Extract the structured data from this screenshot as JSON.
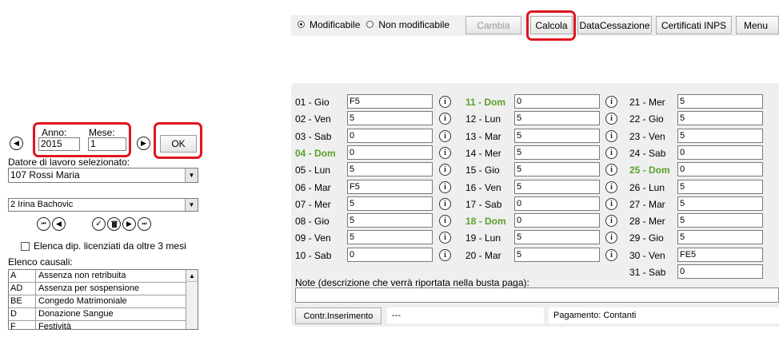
{
  "toolbar": {
    "radio_modificabile": "Modificabile",
    "radio_non_modificabile": "Non modificabile",
    "cambia": "Cambia",
    "calcola": "Calcola",
    "data_cessazione": "DataCessazione",
    "certificati_inps": "Certificati INPS",
    "menu": "Menu"
  },
  "left": {
    "anno_label": "Anno:",
    "mese_label": "Mese:",
    "anno_value": "2015",
    "mese_value": "1",
    "ok": "OK",
    "datore_label": "Datore di lavoro selezionato:",
    "datore_value": "107 Rossi Maria",
    "dipendente_value": "2 Irina Bachovic",
    "elenca_label": "Elenca dip. licenziati da oltre 3 mesi",
    "causali_label": "Elenco causali:",
    "causali": [
      {
        "code": "A",
        "desc": "Assenza non retribuita"
      },
      {
        "code": "AD",
        "desc": "Assenza per sospensione"
      },
      {
        "code": "BE",
        "desc": "Congedo Matrimoniale"
      },
      {
        "code": "D",
        "desc": "Donazione Sangue"
      },
      {
        "code": "F",
        "desc": "Festività"
      }
    ]
  },
  "calendar": {
    "col1": [
      {
        "label": "01 - Gio",
        "value": "F5",
        "sunday": false
      },
      {
        "label": "02 - Ven",
        "value": "5",
        "sunday": false
      },
      {
        "label": "03 - Sab",
        "value": "0",
        "sunday": false
      },
      {
        "label": "04 - Dom",
        "value": "0",
        "sunday": true
      },
      {
        "label": "05 - Lun",
        "value": "5",
        "sunday": false
      },
      {
        "label": "06 - Mar",
        "value": "F5",
        "sunday": false
      },
      {
        "label": "07 - Mer",
        "value": "5",
        "sunday": false
      },
      {
        "label": "08 - Gio",
        "value": "5",
        "sunday": false
      },
      {
        "label": "09 - Ven",
        "value": "5",
        "sunday": false
      },
      {
        "label": "10 - Sab",
        "value": "0",
        "sunday": false
      }
    ],
    "col2": [
      {
        "label": "11 - Dom",
        "value": "0",
        "sunday": true
      },
      {
        "label": "12 - Lun",
        "value": "5",
        "sunday": false
      },
      {
        "label": "13 - Mar",
        "value": "5",
        "sunday": false
      },
      {
        "label": "14 - Mer",
        "value": "5",
        "sunday": false
      },
      {
        "label": "15 - Gio",
        "value": "5",
        "sunday": false
      },
      {
        "label": "16 - Ven",
        "value": "5",
        "sunday": false
      },
      {
        "label": "17 - Sab",
        "value": "0",
        "sunday": false
      },
      {
        "label": "18 - Dom",
        "value": "0",
        "sunday": true
      },
      {
        "label": "19 - Lun",
        "value": "5",
        "sunday": false
      },
      {
        "label": "20 - Mar",
        "value": "5",
        "sunday": false
      }
    ],
    "col3": [
      {
        "label": "21 - Mer",
        "value": "5",
        "sunday": false
      },
      {
        "label": "22 - Gio",
        "value": "5",
        "sunday": false
      },
      {
        "label": "23 - Ven",
        "value": "5",
        "sunday": false
      },
      {
        "label": "24 - Sab",
        "value": "0",
        "sunday": false
      },
      {
        "label": "25 - Dom",
        "value": "0",
        "sunday": true
      },
      {
        "label": "26 - Lun",
        "value": "5",
        "sunday": false
      },
      {
        "label": "27 - Mar",
        "value": "5",
        "sunday": false
      },
      {
        "label": "28 - Mer",
        "value": "5",
        "sunday": false
      },
      {
        "label": "29 - Gio",
        "value": "5",
        "sunday": false
      },
      {
        "label": "30 - Ven",
        "value": "FE5",
        "sunday": false
      },
      {
        "label": "31 - Sab",
        "value": "0",
        "sunday": false
      }
    ],
    "info_glyph": "i",
    "note_label": "Note (descrizione che verrà riportata nella busta paga):",
    "contr_button": "Contr.Inserimento",
    "status_value": "---",
    "pagamento": "Pagamento: Contanti"
  },
  "colors": {
    "highlight": "#e0141e",
    "sunday": "#5aa12a",
    "panel": "#efefef"
  }
}
